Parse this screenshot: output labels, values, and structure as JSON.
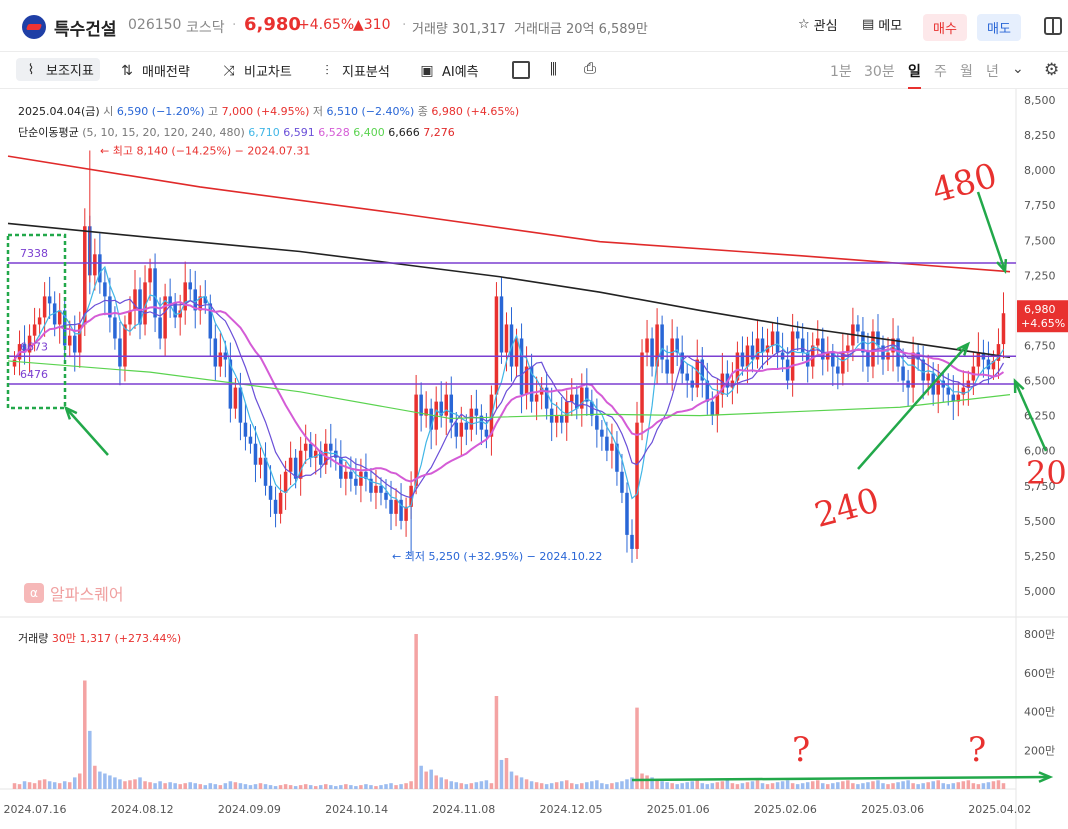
{
  "header": {
    "name": "특수건설",
    "code": "026150",
    "market": "코스닥",
    "separator": "·",
    "price": "6,980",
    "change_pct": "+4.65%",
    "change": "▲310",
    "volume_text": "거래량 301,317",
    "amount_text": "거래대금 20억 6,589만",
    "favorite_label": "관심",
    "memo_label": "메모",
    "buy_label": "매수",
    "sell_label": "매도"
  },
  "toolbar": {
    "items": [
      "보조지표",
      "매매전략",
      "비교차트",
      "지표분석",
      "AI예측"
    ],
    "timeframes": [
      "1분",
      "30분",
      "일",
      "주",
      "월",
      "년"
    ],
    "selected_timeframe": "일",
    "more": "⌄"
  },
  "info": {
    "date": "2025.04.04(금)",
    "open_label": "시",
    "open": "6,590 (−1.20%)",
    "high_label": "고",
    "high": "7,000 (+4.95%)",
    "low_label": "저",
    "low": "6,510 (−2.40%)",
    "close_label": "종",
    "close": "6,980 (+4.65%)",
    "ma_label": "단순이동평균",
    "ma_periods": "(5, 10, 15, 20, 120, 240, 480)",
    "ma_values": [
      {
        "value": "6,710",
        "color": "#41b6e6"
      },
      {
        "value": "6,591",
        "color": "#6a4fd8"
      },
      {
        "value": "6,528",
        "color": "#d45cd6"
      },
      {
        "value": "6,400",
        "color": "#5ad34f"
      },
      {
        "value": "6,666",
        "color": "#222222"
      },
      {
        "value": "7,276",
        "color": "#e02a2a"
      }
    ],
    "volume_label": "거래량",
    "volume_value": "30만 1,317 (+273.44%)",
    "watermark": "알파스퀘어",
    "watermark_icon": "α"
  },
  "chart_data": {
    "type": "candlestick",
    "price_axis": {
      "min": 5000,
      "max": 8500,
      "ticks": [
        "8,500",
        "8,250",
        "8,000",
        "7,750",
        "7,500",
        "7,250",
        "7,000",
        "6,750",
        "6,500",
        "6,250",
        "6,000",
        "5,750",
        "5,500",
        "5,250",
        "5,000"
      ]
    },
    "volume_axis": {
      "ticks": [
        "800만",
        "600만",
        "400만",
        "200만"
      ]
    },
    "x_ticks": [
      "2024.07.16",
      "2024.08.12",
      "2024.09.09",
      "2024.10.14",
      "2024.11.08",
      "2024.12.05",
      "2025.01.06",
      "2025.02.06",
      "2025.03.06",
      "2025.04.02"
    ],
    "current_price_label": {
      "price": "6,980",
      "pct": "+4.65%"
    },
    "annotations": {
      "high": "← 최고 8,140 (−14.25%) − 2024.07.31",
      "low": "← 최저 5,250 (+32.95%) − 2024.10.22",
      "levels": [
        {
          "label": "7338",
          "value": 7338
        },
        {
          "label": "6673",
          "value": 6673
        },
        {
          "label": "6476",
          "value": 6476
        }
      ],
      "handwritten": [
        "480",
        "240",
        "20",
        "?",
        "?"
      ]
    },
    "closes": [
      6650,
      6760,
      6700,
      6820,
      6900,
      6950,
      7100,
      7050,
      6900,
      7000,
      6750,
      6820,
      6700,
      6900,
      7600,
      7250,
      7400,
      7200,
      7100,
      6950,
      6800,
      6600,
      6900,
      7000,
      7150,
      6900,
      7200,
      7300,
      6950,
      6800,
      7100,
      7050,
      6950,
      7000,
      7200,
      7150,
      7000,
      7100,
      7050,
      6800,
      6600,
      6700,
      6650,
      6300,
      6450,
      6200,
      6100,
      6050,
      5900,
      5950,
      5750,
      5650,
      5550,
      5700,
      5850,
      5950,
      5800,
      6000,
      6050,
      5950,
      6000,
      5900,
      6050,
      6000,
      5950,
      5800,
      5850,
      5800,
      5750,
      5850,
      5800,
      5700,
      5750,
      5700,
      5650,
      5550,
      5650,
      5500,
      5600,
      5750,
      6400,
      6250,
      6300,
      6150,
      6350,
      6250,
      6400,
      6200,
      6100,
      6200,
      6150,
      6300,
      6250,
      6150,
      6100,
      6400,
      7100,
      6700,
      6900,
      6600,
      6800,
      6400,
      6600,
      6350,
      6400,
      6450,
      6300,
      6200,
      6250,
      6200,
      6350,
      6400,
      6300,
      6450,
      6350,
      6250,
      6150,
      6100,
      6000,
      6050,
      5850,
      5700,
      5400,
      5300,
      6200,
      6700,
      6800,
      6600,
      6900,
      6650,
      6550,
      6800,
      6700,
      6550,
      6500,
      6450,
      6650,
      6500,
      6350,
      6250,
      6400,
      6550,
      6450,
      6500,
      6700,
      6600,
      6750,
      6650,
      6800,
      6700,
      6750,
      6850,
      6700,
      6650,
      6500,
      6850,
      6800,
      6700,
      6600,
      6750,
      6800,
      6650,
      6700,
      6600,
      6550,
      6700,
      6750,
      6900,
      6850,
      6700,
      6600,
      6850,
      6750,
      6650,
      6700,
      6800,
      6600,
      6500,
      6450,
      6700,
      6650,
      6500,
      6550,
      6400,
      6500,
      6450,
      6400,
      6350,
      6400,
      6450,
      6500,
      6600,
      6700,
      6650,
      6580,
      6640,
      6760,
      6980
    ],
    "volumes": [
      30,
      25,
      40,
      35,
      30,
      45,
      50,
      40,
      35,
      30,
      40,
      35,
      60,
      80,
      560,
      300,
      120,
      90,
      80,
      70,
      60,
      50,
      40,
      45,
      50,
      60,
      40,
      35,
      30,
      40,
      30,
      35,
      30,
      25,
      30,
      35,
      30,
      25,
      20,
      30,
      25,
      20,
      30,
      40,
      35,
      30,
      25,
      20,
      25,
      30,
      25,
      20,
      15,
      20,
      25,
      20,
      15,
      20,
      25,
      20,
      15,
      20,
      25,
      20,
      15,
      20,
      25,
      20,
      15,
      20,
      25,
      20,
      15,
      20,
      25,
      30,
      20,
      25,
      30,
      40,
      800,
      120,
      90,
      100,
      70,
      60,
      50,
      40,
      35,
      30,
      25,
      30,
      35,
      40,
      45,
      30,
      480,
      150,
      160,
      90,
      70,
      60,
      50,
      40,
      35,
      30,
      25,
      30,
      35,
      40,
      45,
      30,
      25,
      30,
      35,
      40,
      45,
      30,
      25,
      30,
      35,
      40,
      50,
      60,
      420,
      80,
      70,
      60,
      50,
      40,
      35,
      30,
      25,
      30,
      35,
      40,
      45,
      30,
      25,
      30,
      35,
      40,
      45,
      30,
      25,
      30,
      35,
      40,
      45,
      30,
      25,
      30,
      35,
      40,
      45,
      30,
      25,
      30,
      35,
      40,
      45,
      30,
      25,
      30,
      35,
      40,
      45,
      30,
      25,
      30,
      35,
      40,
      45,
      30,
      25,
      30,
      35,
      40,
      45,
      30,
      25,
      30,
      35,
      40,
      45,
      30,
      25,
      30,
      35,
      40,
      45,
      30,
      25,
      30,
      35,
      40,
      45,
      30,
      25,
      30,
      35,
      40,
      45,
      30
    ]
  }
}
